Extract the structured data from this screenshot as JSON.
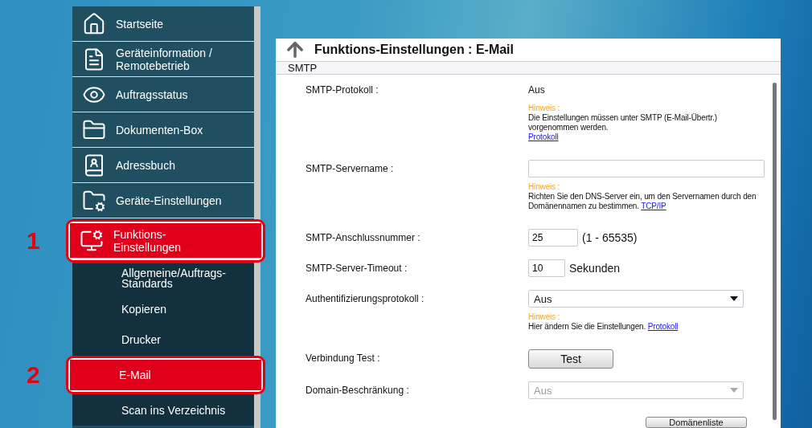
{
  "sidebar": {
    "items": [
      {
        "label": "Startseite",
        "selected": false
      },
      {
        "label": "Geräteinformation / Remotebetrieb",
        "selected": false
      },
      {
        "label": "Auftragsstatus",
        "selected": false
      },
      {
        "label": "Dokumenten-Box",
        "selected": false
      },
      {
        "label": "Adressbuch",
        "selected": false
      },
      {
        "label": "Geräte-Einstellungen",
        "selected": false
      },
      {
        "label": "Funktions-Einstellungen",
        "selected": true,
        "callout": "1",
        "children": [
          {
            "label": "Allgemeine/Auftrags-Standards",
            "selected": false
          },
          {
            "label": "Kopieren",
            "selected": false
          },
          {
            "label": "Drucker",
            "selected": false
          },
          {
            "label": "E-Mail",
            "selected": true,
            "callout": "2"
          },
          {
            "label": "Scan ins Verzeichnis",
            "selected": false
          }
        ]
      }
    ]
  },
  "panel": {
    "title": "Funktions-Einstellungen : E-Mail",
    "section": "SMTP",
    "rows": [
      {
        "kind": "text",
        "label": "SMTP-Protokoll :",
        "value": "Aus",
        "note": {
          "heading": "Hinweis :",
          "text": "Die Einstellungen müssen unter SMTP (E-Mail-Übertr.) vorgenommen werden.",
          "link": "Protokoll",
          "link_on_new_line": true
        }
      },
      {
        "kind": "input",
        "label": "SMTP-Servername :",
        "note": {
          "heading": "Hinweis :",
          "text": "Richten Sie den DNS-Server ein, um den Servernamen durch den Domänennamen zu bestimmen.",
          "link": "TCP/IP",
          "link_on_new_line": false
        }
      },
      {
        "kind": "input",
        "label": "SMTP-Anschlussnummer :",
        "value": "25",
        "unit": "(1 - 65535)"
      },
      {
        "kind": "input",
        "label": "SMTP-Server-Timeout :",
        "value": "10",
        "unit": "Sekunden"
      },
      {
        "kind": "select",
        "label": "Authentifizierungsprotokoll :",
        "value": "Aus",
        "disabled": false,
        "note": {
          "heading": "Hinweis :",
          "text": "Hier ändern Sie die Einstellungen.",
          "link": "Protokoll",
          "link_on_new_line": false
        }
      },
      {
        "kind": "button",
        "label": "Verbindung Test :",
        "value": "Test"
      },
      {
        "kind": "select",
        "label": "Domain-Beschränkung :",
        "value": "Aus",
        "disabled": true
      },
      {
        "kind": "side-button",
        "value": "Domänenliste"
      }
    ]
  }
}
